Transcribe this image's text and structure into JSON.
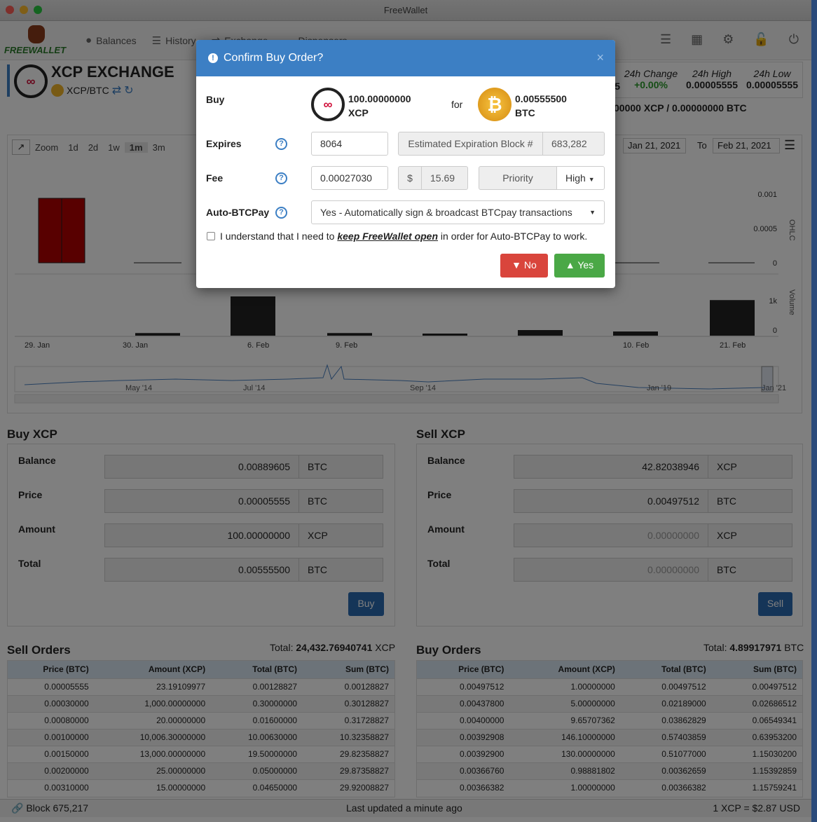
{
  "window": {
    "title": "FreeWallet"
  },
  "nav": {
    "logo": "FREEWALLET",
    "items": [
      {
        "label": "Balances",
        "icon": "user-icon"
      },
      {
        "label": "History",
        "icon": "list-icon"
      },
      {
        "label": "Exchange",
        "icon": "exchange-icon"
      },
      {
        "label": "Dispensers",
        "icon": "arrows-icon"
      }
    ]
  },
  "exchange": {
    "title": "XCP EXCHANGE",
    "pair": "XCP/BTC",
    "stats": {
      "change_label": "24h Change",
      "change_value": "+0.00%",
      "high_label": "24h High",
      "high_value": "0.00005555",
      "low_label": "24h Low",
      "low_value": "0.00005555",
      "partial_value": "5",
      "volume": "00000 XCP / 0.00000000 BTC"
    }
  },
  "chart": {
    "zoom_label": "Zoom",
    "ranges": [
      "1d",
      "2d",
      "1w",
      "1m",
      "3m"
    ],
    "selected_range": "1m",
    "from_value": "Jan 21, 2021",
    "to_label": "To",
    "to_value": "Feb 21, 2021",
    "ohlc_label": "OHLC",
    "volume_label": "Volume",
    "ohlc_ticks": [
      "0.001",
      "0.0005",
      "0"
    ],
    "volume_ticks": [
      "1k",
      "0"
    ],
    "x_ticks": [
      "29. Jan",
      "30. Jan",
      "6. Feb",
      "9. Feb",
      "10. Feb",
      "21. Feb"
    ],
    "nav_ticks": [
      "May '14",
      "Jul '14",
      "Sep '14",
      "Jan '19",
      "Jan '21"
    ]
  },
  "chart_data": {
    "type": "bar",
    "categories": [
      "29. Jan",
      "30. Jan",
      "6. Feb",
      "9. Feb",
      "10. Feb",
      "21. Feb"
    ],
    "series": [
      {
        "values": [
          0,
          50,
          750,
          50,
          80,
          680
        ]
      }
    ],
    "ylabel": "Volume"
  },
  "modal": {
    "title": "Confirm Buy Order?",
    "buy_label": "Buy",
    "buy_amount": "100.00000000",
    "buy_asset": "XCP",
    "for_label": "for",
    "for_amount": "0.00555500",
    "for_asset": "BTC",
    "expires_label": "Expires",
    "expires_value": "8064",
    "est_block_label": "Estimated Expiration Block #",
    "est_block_value": "683,282",
    "fee_label": "Fee",
    "fee_value": "0.00027030",
    "fee_currency": "$",
    "fee_usd": "15.69",
    "priority_label": "Priority",
    "priority_value": "High",
    "autobtc_label": "Auto-BTCPay",
    "autobtc_value": "Yes - Automatically sign & broadcast BTCpay transactions",
    "ack_prefix": "I understand that I need to ",
    "ack_emph": "keep FreeWallet open",
    "ack_suffix": " in order for Auto-BTCPay to work.",
    "no_label": "No",
    "yes_label": "Yes"
  },
  "buy": {
    "title": "Buy XCP",
    "balance_label": "Balance",
    "balance_value": "0.00889605",
    "balance_unit": "BTC",
    "price_label": "Price",
    "price_value": "0.00005555",
    "price_unit": "BTC",
    "amount_label": "Amount",
    "amount_value": "100.00000000",
    "amount_unit": "XCP",
    "total_label": "Total",
    "total_value": "0.00555500",
    "total_unit": "BTC",
    "button": "Buy"
  },
  "sell": {
    "title": "Sell XCP",
    "balance_label": "Balance",
    "balance_value": "42.82038946",
    "balance_unit": "XCP",
    "price_label": "Price",
    "price_value": "0.00497512",
    "price_unit": "BTC",
    "amount_label": "Amount",
    "amount_value": "0.00000000",
    "amount_unit": "XCP",
    "total_label": "Total",
    "total_value": "0.00000000",
    "total_unit": "BTC",
    "button": "Sell"
  },
  "sell_orders": {
    "title": "Sell Orders",
    "total_label": "Total:",
    "total_value": "24,432.76940741",
    "total_unit": "XCP",
    "headers": [
      "Price (BTC)",
      "Amount (XCP)",
      "Total (BTC)",
      "Sum (BTC)"
    ],
    "rows": [
      [
        "0.00005555",
        "23.19109977",
        "0.00128827",
        "0.00128827"
      ],
      [
        "0.00030000",
        "1,000.00000000",
        "0.30000000",
        "0.30128827"
      ],
      [
        "0.00080000",
        "20.00000000",
        "0.01600000",
        "0.31728827"
      ],
      [
        "0.00100000",
        "10,006.30000000",
        "10.00630000",
        "10.32358827"
      ],
      [
        "0.00150000",
        "13,000.00000000",
        "19.50000000",
        "29.82358827"
      ],
      [
        "0.00200000",
        "25.00000000",
        "0.05000000",
        "29.87358827"
      ],
      [
        "0.00310000",
        "15.00000000",
        "0.04650000",
        "29.92008827"
      ]
    ]
  },
  "buy_orders": {
    "title": "Buy Orders",
    "total_label": "Total:",
    "total_value": "4.89917971",
    "total_unit": "BTC",
    "headers": [
      "Price (BTC)",
      "Amount (XCP)",
      "Total (BTC)",
      "Sum (BTC)"
    ],
    "rows": [
      [
        "0.00497512",
        "1.00000000",
        "0.00497512",
        "0.00497512"
      ],
      [
        "0.00437800",
        "5.00000000",
        "0.02189000",
        "0.02686512"
      ],
      [
        "0.00400000",
        "9.65707362",
        "0.03862829",
        "0.06549341"
      ],
      [
        "0.00392908",
        "146.10000000",
        "0.57403859",
        "0.63953200"
      ],
      [
        "0.00392900",
        "130.00000000",
        "0.51077000",
        "1.15030200"
      ],
      [
        "0.00366760",
        "0.98881802",
        "0.00362659",
        "1.15392859"
      ],
      [
        "0.00366382",
        "1.00000000",
        "0.00366382",
        "1.15759241"
      ]
    ]
  },
  "footer": {
    "block": "Block 675,217",
    "updated": "Last updated a minute ago",
    "price": "1 XCP = $2.87 USD"
  }
}
